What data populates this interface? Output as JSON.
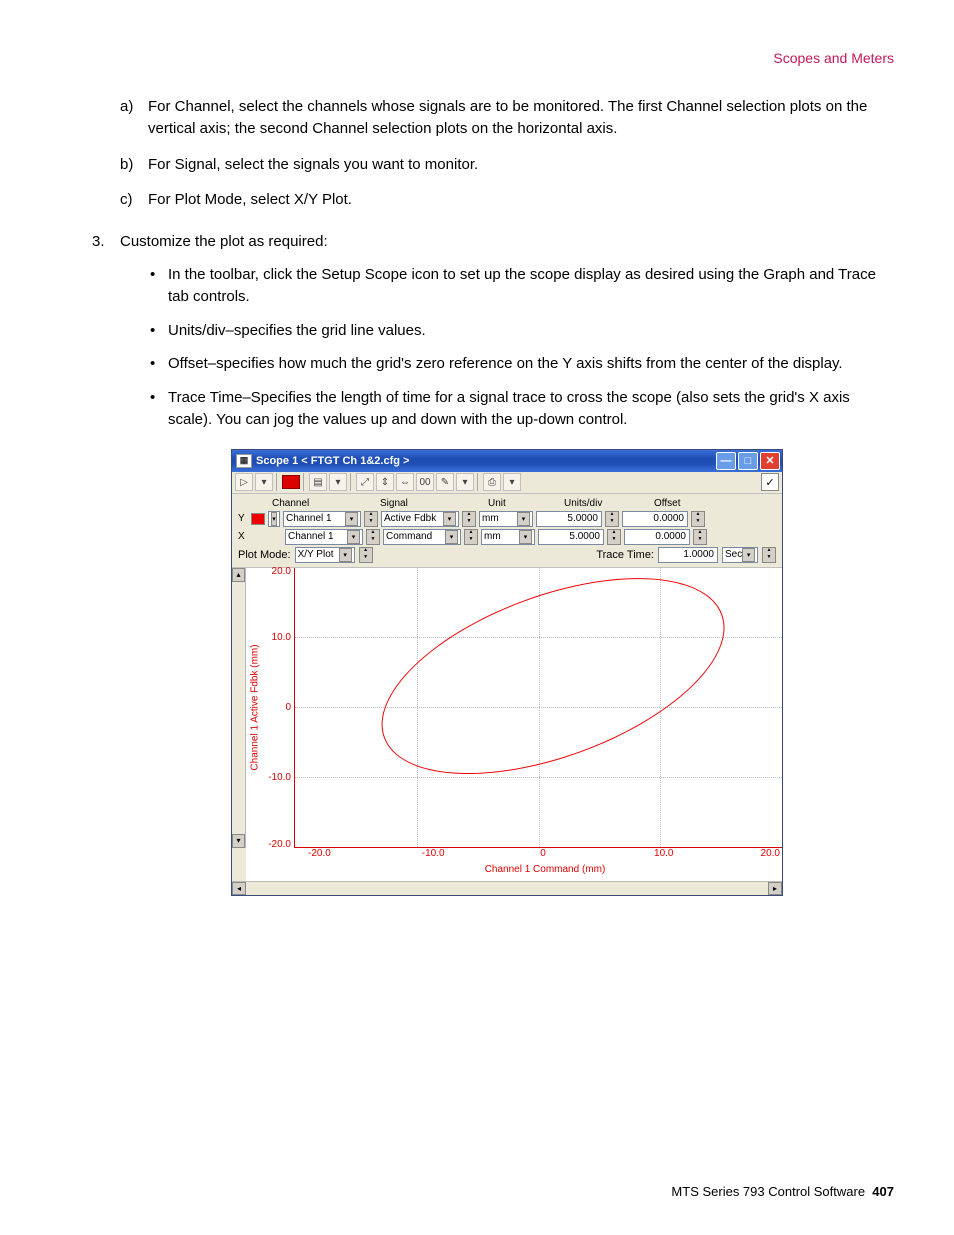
{
  "header": {
    "section_title": "Scopes and Meters"
  },
  "doc": {
    "a_label": "a)",
    "a_text": "For Channel, select the channels whose signals are to be monitored. The first Channel selection plots on the vertical axis; the second Channel selection plots on the horizontal axis.",
    "b_label": "b)",
    "b_text": "For Signal, select the signals you want to monitor.",
    "c_label": "c)",
    "c_text": "For Plot Mode, select X/Y Plot.",
    "step3_marker": "3.",
    "step3_text": "Customize the plot as required:",
    "bullets": [
      "In the toolbar, click the Setup Scope icon to set up the scope display as desired using the Graph and Trace tab controls.",
      "Units/div–specifies the grid line values.",
      "Offset–specifies how much the grid's zero reference on the Y axis shifts from the center of the display.",
      "Trace Time–Specifies the length of time for a signal trace to cross the scope (also sets the grid's X axis scale). You can jog the values up and down with the up-down control."
    ]
  },
  "win": {
    "title": "Scope  1 < FTGT Ch 1&2.cfg >",
    "head": {
      "channel": "Channel",
      "signal": "Signal",
      "unit": "Unit",
      "unitsdiv": "Units/div",
      "offset": "Offset"
    },
    "rowY": {
      "axis": "Y",
      "channel": "Channel 1",
      "signal": "Active Fdbk",
      "unit": "mm",
      "unitsdiv": "5.0000",
      "offset": "0.0000"
    },
    "rowX": {
      "axis": "X",
      "channel": "Channel 1",
      "signal": "Command",
      "unit": "mm",
      "unitsdiv": "5.0000",
      "offset": "0.0000"
    },
    "plotmode_label": "Plot Mode:",
    "plotmode_value": "X/Y Plot",
    "tracetime_label": "Trace Time:",
    "tracetime_value": "1.0000",
    "tracetime_unit": "Sec"
  },
  "chart_data": {
    "type": "scatter",
    "title": "",
    "xlabel": "Channel 1 Command (mm)",
    "ylabel": "Channel 1 Active Fdbk (mm)",
    "xlim": [
      -20.0,
      20.0
    ],
    "ylim": [
      -20.0,
      20.0
    ],
    "xticks": [
      -20.0,
      -10.0,
      0,
      10.0,
      20.0
    ],
    "yticks": [
      -20.0,
      -10.0,
      0,
      10.0,
      20.0
    ],
    "series": [
      {
        "name": "Trace",
        "color": "#e00000",
        "shape": "ellipse",
        "approx_extent": {
          "x_min": -14,
          "x_max": 18,
          "y_min": -12,
          "y_max": 15
        }
      }
    ],
    "xticks_str": {
      "0": "-20.0",
      "1": "-10.0",
      "2": "0",
      "3": "10.0",
      "4": "20.0"
    },
    "yticks_str": {
      "0": "20.0",
      "1": "10.0",
      "2": "0",
      "3": "-10.0",
      "4": "-20.0"
    }
  },
  "footer": {
    "product": "MTS Series 793 Control Software",
    "page": "407"
  }
}
